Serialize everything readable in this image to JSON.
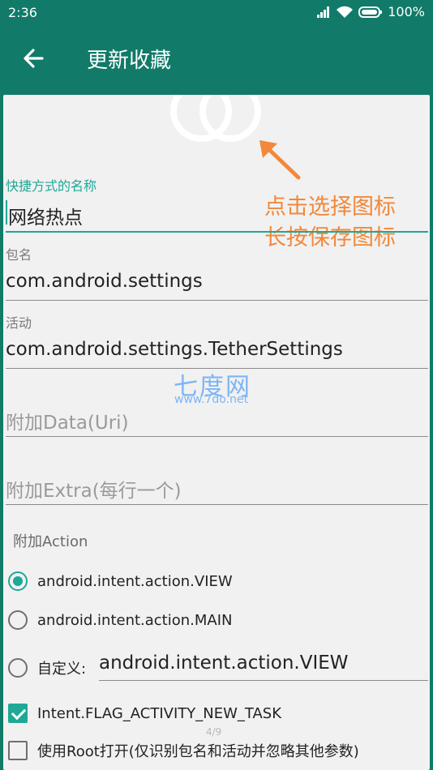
{
  "status": {
    "time": "2:36",
    "battery": "100%"
  },
  "appbar": {
    "title": "更新收藏"
  },
  "hint": {
    "line1": "点击选择图标",
    "line2": "长按保存图标"
  },
  "form": {
    "shortcut_name_label": "快捷方式的名称",
    "shortcut_name_value": "网络热点",
    "package_label": "包名",
    "package_value": "com.android.settings",
    "activity_label": "活动",
    "activity_value": "com.android.settings.TetherSettings",
    "data_placeholder": "附加Data(Uri)",
    "extra_placeholder": "附加Extra(每行一个)"
  },
  "watermark": {
    "cn": "七度网",
    "en": "www.7do.net"
  },
  "action": {
    "label": "附加Action",
    "options": [
      {
        "label": "android.intent.action.VIEW",
        "selected": true
      },
      {
        "label": "android.intent.action.MAIN",
        "selected": false
      },
      {
        "label": "自定义:",
        "selected": false
      }
    ],
    "custom_value": "android.intent.action.VIEW"
  },
  "flags": [
    {
      "label": "Intent.FLAG_ACTIVITY_NEW_TASK",
      "checked": true
    },
    {
      "label": "使用Root打开(仅识别包名和活动并忽略其他参数)",
      "checked": false
    }
  ],
  "page_indicator": "4/9",
  "colors": {
    "appbar": "#117a68",
    "accent": "#1ea896",
    "hint": "#f2883a",
    "watermark": "#7db5f5"
  }
}
